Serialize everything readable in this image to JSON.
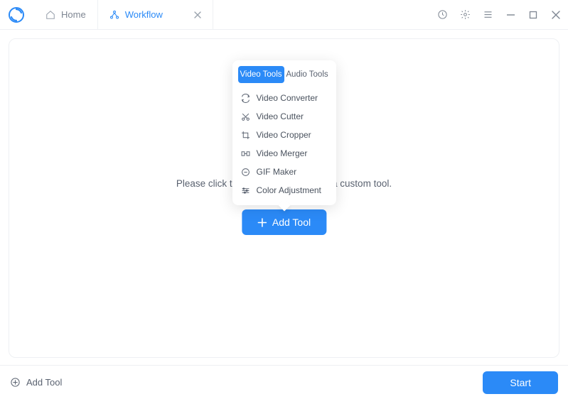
{
  "titlebar": {
    "tabs": [
      {
        "label": "Home",
        "icon": "home-icon",
        "active": false
      },
      {
        "label": "Workflow",
        "icon": "workflow-icon",
        "active": true
      }
    ]
  },
  "main": {
    "instruction": "Please click the button below to add a custom tool.",
    "add_tool_label": "Add Tool"
  },
  "popover": {
    "tabs": {
      "video": "Video Tools",
      "audio": "Audio Tools"
    },
    "tools": [
      {
        "label": "Video Converter",
        "icon": "convert-icon"
      },
      {
        "label": "Video Cutter",
        "icon": "cut-icon"
      },
      {
        "label": "Video Cropper",
        "icon": "crop-icon"
      },
      {
        "label": "Video Merger",
        "icon": "merge-icon"
      },
      {
        "label": "GIF Maker",
        "icon": "gif-icon"
      },
      {
        "label": "Color Adjustment",
        "icon": "color-icon"
      }
    ]
  },
  "bottom": {
    "add_tool_label": "Add Tool",
    "start_label": "Start"
  }
}
